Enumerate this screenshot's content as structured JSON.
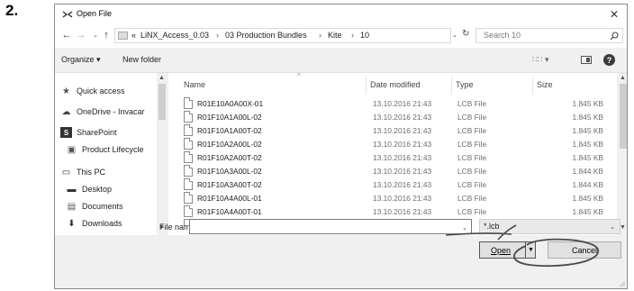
{
  "step": "2.",
  "window": {
    "title": "Open File",
    "close_glyph": "✕"
  },
  "address": {
    "back": "←",
    "forward": "→",
    "recent": "⌄",
    "up": "↑",
    "overflow": "«",
    "crumbs": [
      "LiNX_Access_0.03",
      "03 Production Bundles",
      "Kite",
      "10"
    ],
    "separator": "›",
    "dropdown": "⌄",
    "refresh": "↻",
    "search_placeholder": "Search 10"
  },
  "toolbar": {
    "organize": "Organize ▾",
    "new_folder": "New folder",
    "view_glyph": "∷∷ ▾",
    "help": "?"
  },
  "nav_pane": {
    "items": [
      {
        "label": "Quick access",
        "icon": "star-icon",
        "glyph": "★"
      },
      {
        "label": "OneDrive - Invacar",
        "icon": "cloud-icon",
        "glyph": "☁"
      },
      {
        "label": "SharePoint",
        "icon": "sharepoint-icon",
        "glyph": "S"
      },
      {
        "label": "Product Lifecycle",
        "icon": "sharepoint-site-icon",
        "glyph": "▣"
      },
      {
        "label": "This PC",
        "icon": "computer-icon",
        "glyph": "▭"
      },
      {
        "label": "Desktop",
        "icon": "desktop-icon",
        "glyph": "▬"
      },
      {
        "label": "Documents",
        "icon": "documents-icon",
        "glyph": "▤"
      },
      {
        "label": "Downloads",
        "icon": "downloads-icon",
        "glyph": "⬇"
      }
    ],
    "scroll_up": "▲",
    "scroll_down": "▼"
  },
  "file_list": {
    "columns": {
      "name": "Name",
      "date": "Date modified",
      "type": "Type",
      "size": "Size"
    },
    "sort_indicator": "^",
    "rows": [
      {
        "name": "R01E10A0A00X-01",
        "date": "13.10.2016 21:43",
        "type": "LCB File",
        "size": "1.845 KB"
      },
      {
        "name": "R01F10A1A00L-02",
        "date": "13.10.2016 21:43",
        "type": "LCB File",
        "size": "1.845 KB"
      },
      {
        "name": "R01F10A1A00T-02",
        "date": "13.10.2016 21:43",
        "type": "LCB File",
        "size": "1.845 KB"
      },
      {
        "name": "R01F10A2A00L-02",
        "date": "13.10.2016 21:43",
        "type": "LCB File",
        "size": "1.845 KB"
      },
      {
        "name": "R01F10A2A00T-02",
        "date": "13.10.2016 21:43",
        "type": "LCB File",
        "size": "1.845 KB"
      },
      {
        "name": "R01F10A3A00L-02",
        "date": "13.10.2016 21:43",
        "type": "LCB File",
        "size": "1.844 KB"
      },
      {
        "name": "R01F10A3A00T-02",
        "date": "13.10.2016 21:43",
        "type": "LCB File",
        "size": "1.844 KB"
      },
      {
        "name": "R01F10A4A00L-01",
        "date": "13.10.2016 21:43",
        "type": "LCB File",
        "size": "1.845 KB"
      },
      {
        "name": "R01F10A4A00T-01",
        "date": "13.10.2016 21:43",
        "type": "LCB File",
        "size": "1.845 KB"
      }
    ]
  },
  "bottom": {
    "filename_label": "File name:",
    "filename_value": "",
    "filename_dropdown": "⌄",
    "filter": "*.lcb",
    "filter_dropdown": "⌄",
    "open": "Open",
    "open_split": "▼",
    "cancel": "Cancel"
  },
  "colors": {
    "annotation": "#4a4a4a",
    "window_bg": "#f0f0f0"
  }
}
